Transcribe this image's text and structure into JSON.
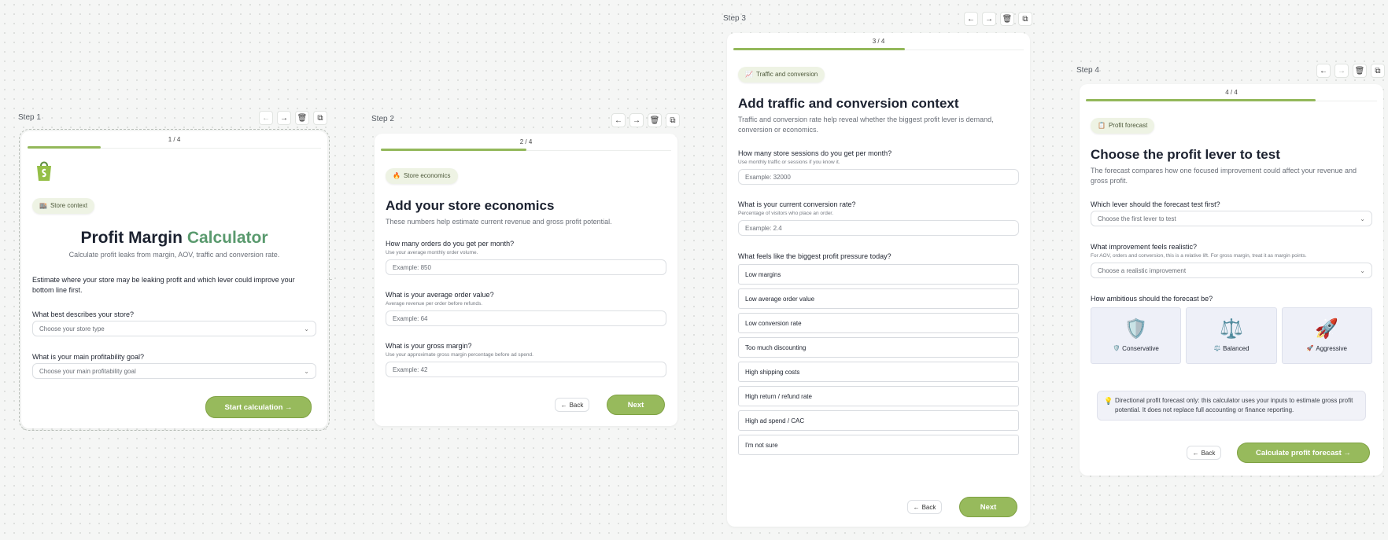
{
  "steps": [
    {
      "label": "Step 1",
      "progress": "1 / 4",
      "progress_fraction": 0.25,
      "logo": "shopify-bag-icon",
      "badge": {
        "icon": "building-icon",
        "text": "Store context"
      },
      "title_main": "Profit Margin",
      "title_accent": "Calculator",
      "subtitle": "Calculate profit leaks from margin, AOV, traffic and conversion rate.",
      "intro": "Estimate where your store may be leaking profit and which lever could improve your bottom line first.",
      "fields": [
        {
          "question": "What best describes your store?",
          "placeholder": "Choose your store type"
        },
        {
          "question": "What is your main profitability goal?",
          "placeholder": "Choose your main profitability goal"
        }
      ],
      "primary": "Start calculation →"
    },
    {
      "label": "Step 2",
      "progress": "2 / 4",
      "progress_fraction": 0.5,
      "badge": {
        "icon": "fire-icon",
        "text": "Store economics"
      },
      "title": "Add your store economics",
      "subtitle": "These numbers help estimate current revenue and gross profit potential.",
      "fields": [
        {
          "question": "How many orders do you get per month?",
          "hint": "Use your average monthly order volume.",
          "placeholder": "Example: 850"
        },
        {
          "question": "What is your average order value?",
          "hint": "Average revenue per order before refunds.",
          "placeholder": "Example: 64"
        },
        {
          "question": "What is your gross margin?",
          "hint": "Use your approximate gross margin percentage before ad spend.",
          "placeholder": "Example: 42"
        }
      ],
      "back": "Back",
      "primary": "Next"
    },
    {
      "label": "Step 3",
      "progress": "3 / 4",
      "progress_fraction": 0.59,
      "badge": {
        "icon": "chart-icon",
        "text": "Traffic and conversion"
      },
      "title": "Add traffic and conversion context",
      "subtitle": "Traffic and conversion rate help reveal whether the biggest profit lever is demand, conversion or economics.",
      "fields": [
        {
          "question": "How many store sessions do you get per month?",
          "hint": "Use monthly traffic or sessions if you know it.",
          "placeholder": "Example: 32000"
        },
        {
          "question": "What is your current conversion rate?",
          "hint": "Percentage of visitors who place an order.",
          "placeholder": "Example: 2.4"
        }
      ],
      "pressure_question": "What feels like the biggest profit pressure today?",
      "options": [
        "Low margins",
        "Low average order value",
        "Low conversion rate",
        "Too much discounting",
        "High shipping costs",
        "High return / refund rate",
        "High ad spend / CAC",
        "I'm not sure"
      ],
      "back": "Back",
      "primary": "Next"
    },
    {
      "label": "Step 4",
      "progress": "4 / 4",
      "progress_fraction": 0.79,
      "badge": {
        "icon": "document-icon",
        "text": "Profit forecast"
      },
      "title": "Choose the profit lever to test",
      "subtitle": "The forecast compares how one focused improvement could affect your revenue and gross profit.",
      "fields": [
        {
          "question": "Which lever should the forecast test first?",
          "placeholder": "Choose the first lever to test"
        },
        {
          "question": "What improvement feels realistic?",
          "hint": "For AOV, orders and conversion, this is a relative lift. For gross margin, treat it as margin points.",
          "placeholder": "Choose a realistic improvement"
        }
      ],
      "ambition_question": "How ambitious should the forecast be?",
      "ambition": [
        {
          "icon": "shield-icon",
          "label": "Conservative"
        },
        {
          "icon": "scales-icon",
          "label": "Balanced"
        },
        {
          "icon": "rocket-icon",
          "label": "Aggressive"
        }
      ],
      "notice": "Directional profit forecast only: this calculator uses your inputs to estimate gross profit potential. It does not replace full accounting or finance reporting.",
      "back": "Back",
      "primary": "Calculate profit forecast →"
    }
  ],
  "toolbar": {
    "prev": "←",
    "next": "→",
    "delete": "🗑",
    "copy": "⧉"
  },
  "glyphs": {
    "back_arrow": "←",
    "chevron": "⌄",
    "bulb": "💡",
    "shield": "🛡️",
    "scales": "⚖️",
    "rocket": "🚀",
    "shield_small": "🛡️",
    "scales_small": "⚖️",
    "rocket_small": "🚀",
    "building": "🏬",
    "fire": "🔥",
    "chart": "📈",
    "document": "📋"
  },
  "colors": {
    "accent": "#97ba5c",
    "accent_text": "#5a9a6e",
    "progress": "#93b85a"
  }
}
